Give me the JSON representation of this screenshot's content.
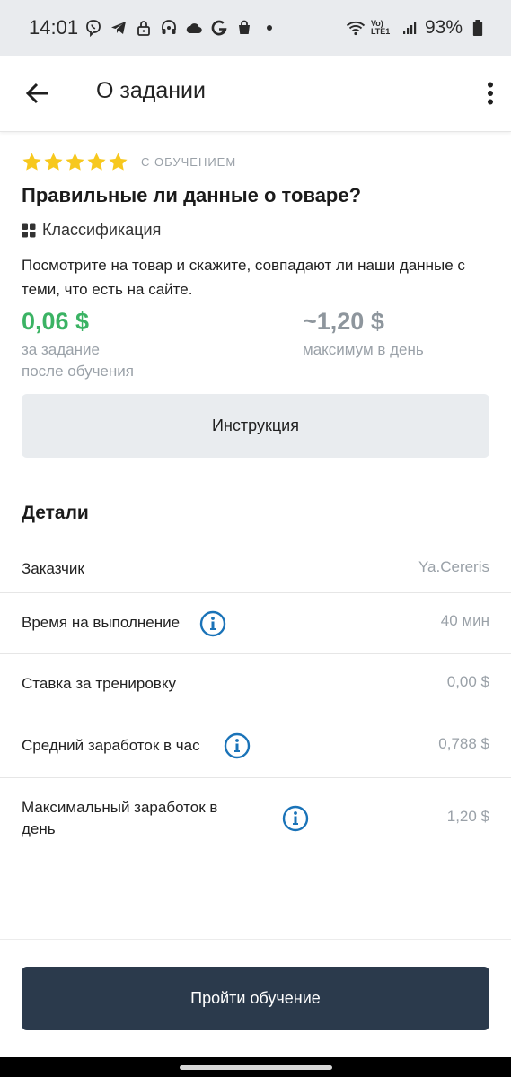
{
  "status_bar": {
    "time": "14:01",
    "left_icons": [
      "viber-icon",
      "telegram-icon",
      "lock-icon",
      "headset-icon",
      "cloud-icon",
      "google-icon",
      "bag-icon",
      "dot-icon"
    ],
    "network_label": "Vo) LTE1",
    "battery": "93%"
  },
  "app_bar": {
    "title": "О задании"
  },
  "task": {
    "rating_stars": 5,
    "badge": "С ОБУЧЕНИЕМ",
    "title": "Правильные ли данные о товаре?",
    "category": "Классификация",
    "description": "Посмотрите на товар и скажите, совпадают ли наши данные с теми, что есть на сайте.",
    "price": "0,06 $",
    "price_sub_1": "за задание",
    "price_sub_2": "после обучения",
    "max_price": "~1,20 $",
    "max_price_sub": "максимум в день"
  },
  "instruction_button": "Инструкция",
  "details": {
    "title": "Детали",
    "rows": [
      {
        "label": "Заказчик",
        "value": "Ya.Cereris",
        "info": false
      },
      {
        "label": "Время на выполнение",
        "value": "40 мин",
        "info": true
      },
      {
        "label": "Ставка за тренировку",
        "value": "0,00 $",
        "info": false
      },
      {
        "label": "Средний заработок в час",
        "value": "0,788 $",
        "info": true
      },
      {
        "label": "Максимальный заработок в день",
        "value": "1,20 $",
        "info": true
      }
    ]
  },
  "train_button": "Пройти обучение",
  "colors": {
    "star": "#f7c81e",
    "price_green": "#3bb364",
    "info_blue": "#1a73b8",
    "primary_button": "#2b3a4c"
  }
}
